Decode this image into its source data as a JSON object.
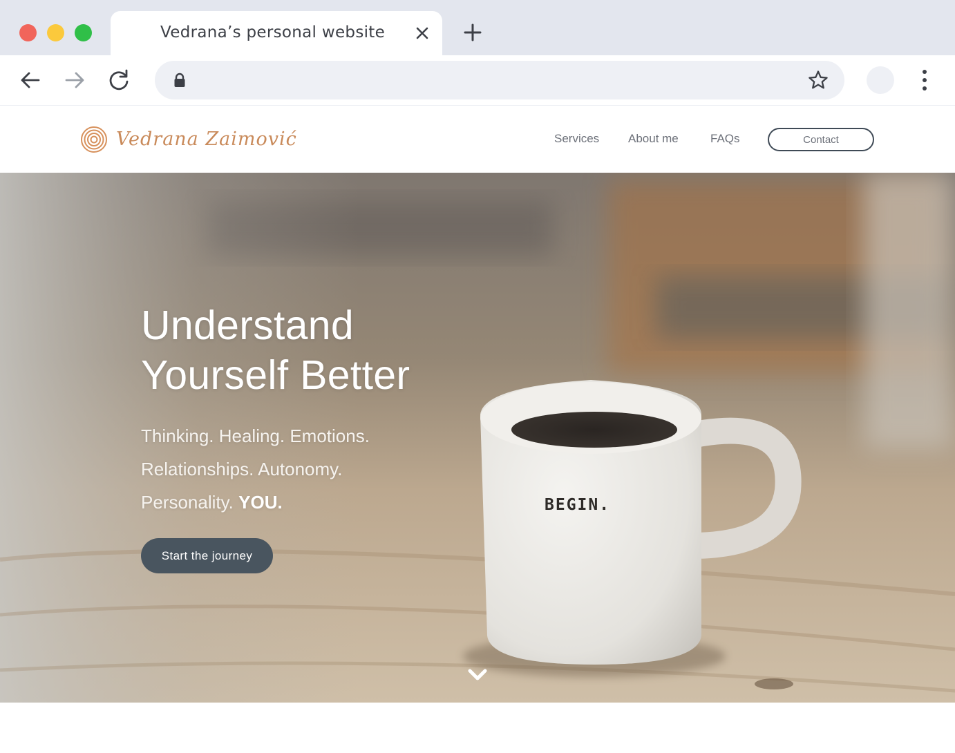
{
  "browser": {
    "tab_title": "Vedrana’s personal website",
    "url": ""
  },
  "site": {
    "logo_text": "Vedrana Zaimović",
    "nav": [
      {
        "label": "Services"
      },
      {
        "label": "About me"
      },
      {
        "label": "FAQs"
      }
    ],
    "contact_label": "Contact"
  },
  "hero": {
    "heading_line1": "Understand",
    "heading_line2": "Yourself Better",
    "sub_line1": "Thinking. Healing. Emotions.",
    "sub_line2": "Relationships. Autonomy.",
    "sub_line3_prefix": "Personality.",
    "sub_line3_emphasis": "YOU.",
    "cta_label": "Start the journey",
    "mug_text": "BEGIN."
  },
  "icons": [
    "close-icon",
    "plus-icon",
    "back-arrow-icon",
    "forward-arrow-icon",
    "reload-icon",
    "lock-icon",
    "star-icon",
    "more-vert-icon",
    "chevron-down-icon",
    "spiral-logo-icon"
  ],
  "colors": {
    "brand": "#c98a5a",
    "cta": "#49555f",
    "chrome_bg": "#e3e6ee",
    "close_red": "#f1655b",
    "min_yellow": "#fbc93c",
    "max_green": "#30bf48"
  }
}
